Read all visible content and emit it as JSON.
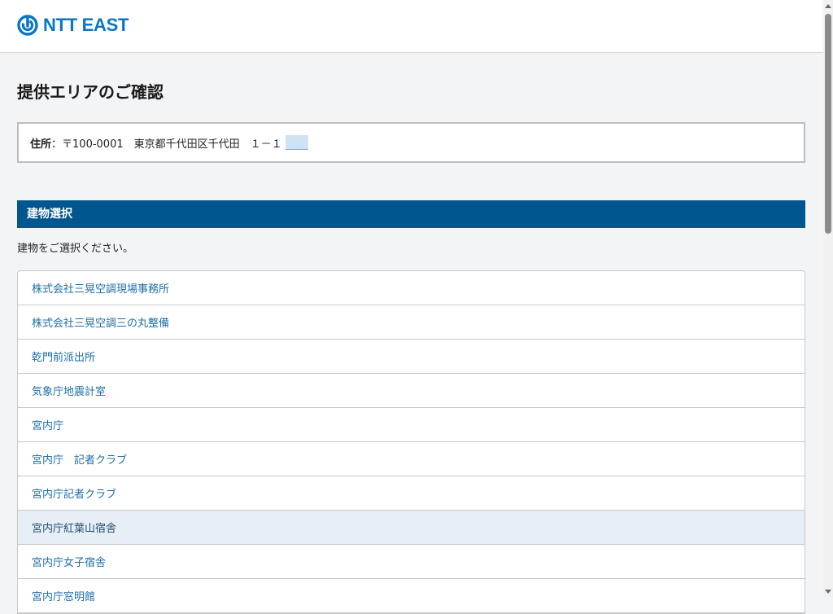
{
  "header": {
    "logo_text": "NTT EAST"
  },
  "page": {
    "title": "提供エリアのご確認"
  },
  "address": {
    "label": "住所",
    "separator": "：",
    "value": "〒100-0001　東京都千代田区千代田　１－１"
  },
  "building_section": {
    "heading": "建物選択",
    "instruction": "建物をご選択ください。",
    "items": [
      {
        "label": "株式会社三晃空調現場事務所"
      },
      {
        "label": "株式会社三晃空調三の丸整備"
      },
      {
        "label": "乾門前派出所"
      },
      {
        "label": "気象庁地震計室"
      },
      {
        "label": "宮内庁"
      },
      {
        "label": "宮内庁　記者クラブ"
      },
      {
        "label": "宮内庁記者クラブ"
      },
      {
        "label": "宮内庁紅葉山宿舎"
      },
      {
        "label": "宮内庁女子宿舎"
      },
      {
        "label": "宮内庁窓明館"
      }
    ]
  },
  "colors": {
    "brand": "#0b76c1",
    "section_bar": "#00568f",
    "link": "#1d6ea8",
    "highlight_row": "#e6eef6"
  },
  "icons": {
    "logo": "ntt-east-logo-icon"
  }
}
